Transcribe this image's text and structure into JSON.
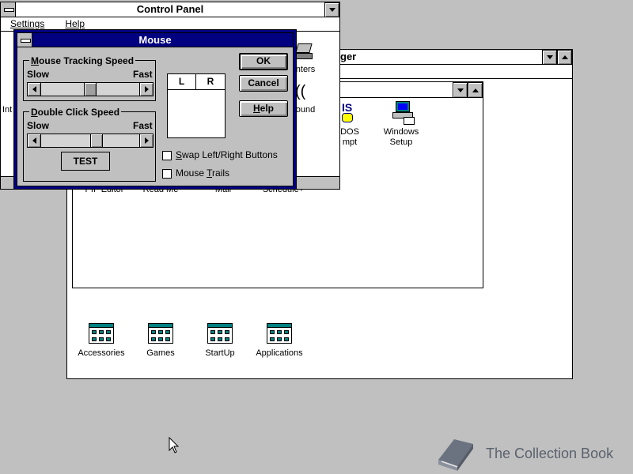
{
  "control_panel": {
    "title": "Control Panel",
    "menu": [
      "Settings",
      "Help"
    ],
    "icons": {
      "printers_label": "nters",
      "sound_label": "ound",
      "partial_left_label": "Int"
    }
  },
  "program_manager": {
    "title_fragment": "ger",
    "main_group": {
      "icons": [
        {
          "label_line1": "DOS",
          "label_line2": "mpt",
          "partial_prefix": "IS"
        },
        {
          "label_line1": "Windows",
          "label_line2": "Setup"
        }
      ],
      "cut_labels": [
        "PIF Editor",
        "Read Me",
        "Mail",
        "Schedule+"
      ]
    },
    "groups": [
      {
        "label": "Accessories"
      },
      {
        "label": "Games"
      },
      {
        "label": "StartUp"
      },
      {
        "label": "Applications"
      }
    ]
  },
  "mouse_dialog": {
    "title": "Mouse",
    "tracking": {
      "group_label_accel": "M",
      "group_label_rest": "ouse Tracking Speed",
      "slow": "Slow",
      "fast": "Fast",
      "level": 0.5
    },
    "double_click": {
      "group_label_accel": "D",
      "group_label_rest": "ouble Click Speed",
      "slow": "Slow",
      "fast": "Fast",
      "level": 0.57
    },
    "test_label": "TEST",
    "buttons_display": {
      "left": "L",
      "right": "R"
    },
    "ok_label": "OK",
    "cancel_label": "Cancel",
    "help_accel": "H",
    "help_rest": "elp",
    "swap": {
      "accel": "S",
      "rest": "wap Left/Right Buttons",
      "checked": false
    },
    "trails": {
      "prefix": "Mouse ",
      "accel": "T",
      "rest": "rails",
      "checked": false
    }
  },
  "watermark": {
    "text": "The Collection Book"
  },
  "colors": {
    "desktop": "#c0c0c0",
    "active_title": "#000080",
    "teal": "#008080"
  }
}
